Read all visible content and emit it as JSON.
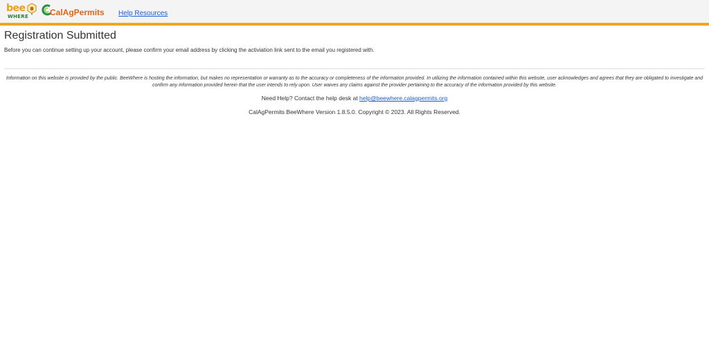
{
  "header": {
    "logo_bee": {
      "word": "bee",
      "subword": "WHERE",
      "bee_color": "#e8a01a",
      "where_color": "#2d7a3a"
    },
    "logo_calag": {
      "word": "CalAgPermits",
      "color": "#e0641b"
    },
    "nav_link_label": "Help Resources",
    "accent_color": "#f0a81b"
  },
  "main": {
    "title": "Registration Submitted",
    "message": "Before you can continue setting up your account, please confirm your email address by clicking the activiation link sent to the email you registered with."
  },
  "footer": {
    "disclaimer": "Information on this website is provided by the public. BeeWhere is hosting the information, but makes no representation or warranty as to the accuracy or completeness of the information provided. In utilizing the information contained within this website, user acknowledges and agrees that they are obligated to investigate and confirm any information provided herein that the user intends to rely upon. User waives any claims against the provider pertaining to the accuracy of the information provided by this website.",
    "help_prefix": "Need Help? Contact the help desk at ",
    "help_email": "help@beewhere.calagpermits.org",
    "copyright": "CalAgPermits BeeWhere Version 1.8.5.0. Copyright © 2023. All Rights Reserved."
  }
}
